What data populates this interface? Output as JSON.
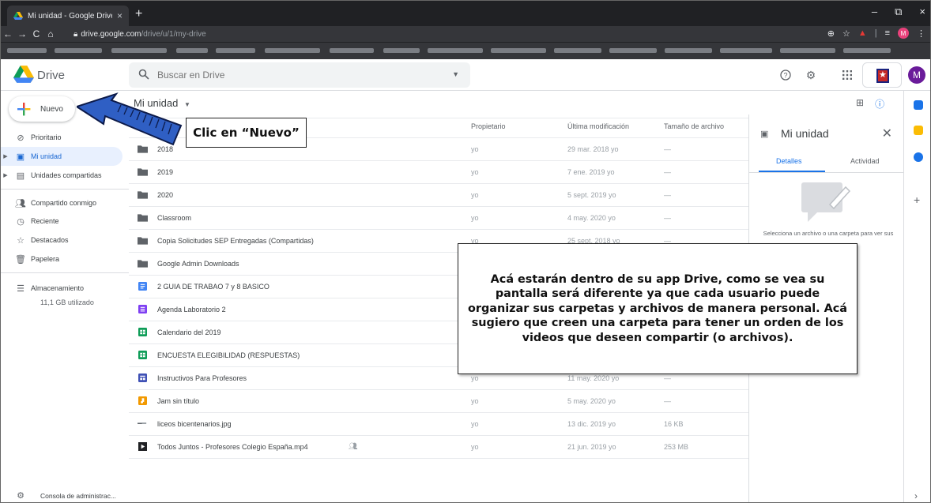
{
  "browser": {
    "tab_title": "Mi unidad - Google Drive",
    "tab_close": "×",
    "new_tab": "+",
    "url_host": "drive.google.com",
    "url_path": "/drive/u/1/my-drive",
    "profile_letter": "M",
    "win_min": "–",
    "win_max": "⧉",
    "win_close": "×"
  },
  "header": {
    "brand": "Drive",
    "search_placeholder": "Buscar en Drive",
    "account_letter": "M"
  },
  "sidebar": {
    "new_label": "Nuevo",
    "items": [
      {
        "label": "Prioritario",
        "icon": "check-circle-icon"
      },
      {
        "label": "Mi unidad",
        "icon": "my-drive-icon"
      },
      {
        "label": "Unidades compartidas",
        "icon": "shared-drives-icon"
      },
      {
        "label": "Compartido conmigo",
        "icon": "shared-with-me-icon"
      },
      {
        "label": "Reciente",
        "icon": "clock-icon"
      },
      {
        "label": "Destacados",
        "icon": "star-icon"
      },
      {
        "label": "Papelera",
        "icon": "trash-icon"
      },
      {
        "label": "Almacenamiento",
        "icon": "storage-icon"
      }
    ],
    "storage_used": "11,1 GB utilizado",
    "admin_console": "Consola de administrac..."
  },
  "main": {
    "breadcrumb": "Mi unidad",
    "columns": {
      "owner": "Propietario",
      "modified": "Última modificación",
      "size": "Tamaño de archivo"
    },
    "files": [
      {
        "name": "2018",
        "type": "folder",
        "owner": "yo",
        "modified": "29 mar. 2018 yo",
        "size": "—"
      },
      {
        "name": "2019",
        "type": "folder",
        "owner": "yo",
        "modified": "7 ene. 2019 yo",
        "size": "—"
      },
      {
        "name": "2020",
        "type": "folder",
        "owner": "yo",
        "modified": "5 sept. 2019 yo",
        "size": "—"
      },
      {
        "name": "Classroom",
        "type": "folder",
        "owner": "yo",
        "modified": "4 may. 2020 yo",
        "size": "—"
      },
      {
        "name": "Copia Solicitudes SEP Entregadas (Compartidas)",
        "type": "folder",
        "owner": "yo",
        "modified": "25 sept. 2018 yo",
        "size": "—"
      },
      {
        "name": "Google Admin Downloads",
        "type": "folder",
        "owner": "",
        "modified": "",
        "size": ""
      },
      {
        "name": "2 GUIA DE TRABAO 7 y 8 BASICO",
        "type": "doc",
        "owner": "",
        "modified": "",
        "size": ""
      },
      {
        "name": "Agenda Laboratorio 2",
        "type": "form",
        "owner": "",
        "modified": "",
        "size": ""
      },
      {
        "name": "Calendario del 2019",
        "type": "sheet",
        "owner": "",
        "modified": "",
        "size": ""
      },
      {
        "name": "ENCUESTA ELEGIBILIDAD (RESPUESTAS)",
        "type": "sheet",
        "owner": "",
        "modified": "",
        "size": ""
      },
      {
        "name": "Instructivos Para Profesores",
        "type": "site",
        "owner": "yo",
        "modified": "11 may. 2020 yo",
        "size": "—"
      },
      {
        "name": "Jam sin título",
        "type": "jam",
        "owner": "yo",
        "modified": "5 may. 2020 yo",
        "size": "—"
      },
      {
        "name": "liceos bicentenarios.jpg",
        "type": "image",
        "owner": "yo",
        "modified": "13 dic. 2019 yo",
        "size": "16 KB"
      },
      {
        "name": "Todos Juntos - Profesores Colegio España.mp4",
        "type": "video",
        "owner": "yo",
        "modified": "21 jun. 2019 yo",
        "size": "253 MB"
      }
    ]
  },
  "details": {
    "title": "Mi unidad",
    "tab_details": "Detalles",
    "tab_activity": "Actividad",
    "message": "Selecciona un archivo o una carpeta para ver sus detalles"
  },
  "annotations": {
    "new_callout": "Clic en “Nuevo”",
    "info_callout": "Acá estarán dentro de su app Drive, como se vea su pantalla será diferente ya que cada usuario puede organizar sus carpetas y archivos de manera personal. Acá sugiero que creen una carpeta para tener un orden de los videos que deseen compartir (o archivos)."
  },
  "colors": {
    "accent_blue": "#1a73e8",
    "arrow_fill": "#2f5fc4",
    "folder": "#5f6368",
    "doc": "#4285f4",
    "form": "#7e3ff2",
    "sheet": "#0f9d58",
    "jam": "#f29900",
    "video": "#202124"
  }
}
